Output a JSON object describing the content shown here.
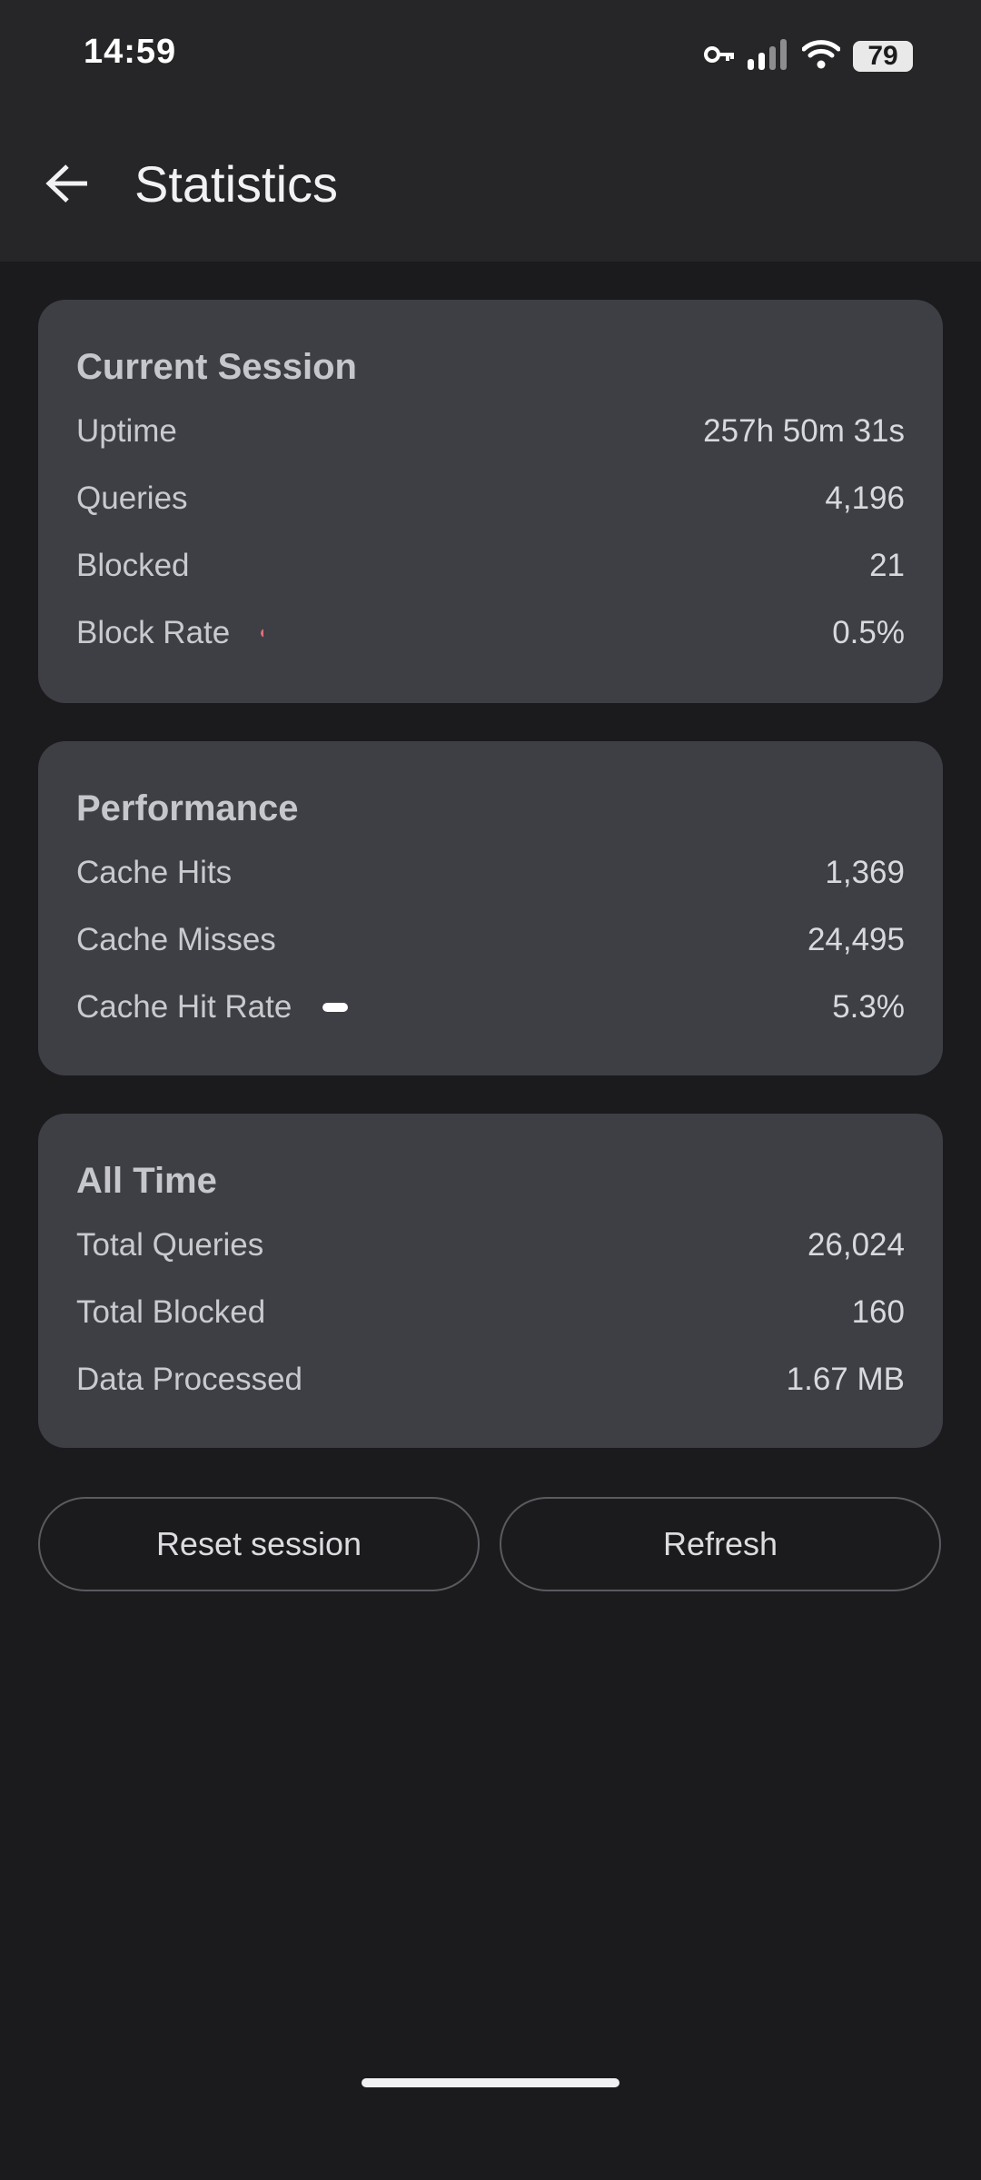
{
  "status_bar": {
    "time": "14:59",
    "battery": "79",
    "icons": [
      "vpn-key-icon",
      "cell-signal-icon",
      "wifi-icon",
      "battery-icon"
    ]
  },
  "header": {
    "title": "Statistics",
    "back_icon": "arrow-left-icon"
  },
  "current_session": {
    "title": "Current Session",
    "rows": [
      {
        "label": "Uptime",
        "value": "257h 50m 31s"
      },
      {
        "label": "Queries",
        "value": "4,196"
      },
      {
        "label": "Blocked",
        "value": "21"
      },
      {
        "label": "Block Rate",
        "value": "0.5%",
        "bar_fraction": 0.005,
        "bar_color": "#e0707a"
      }
    ]
  },
  "performance": {
    "title": "Performance",
    "rows": [
      {
        "label": "Cache Hits",
        "value": "1,369"
      },
      {
        "label": "Cache Misses",
        "value": "24,495"
      },
      {
        "label": "Cache Hit Rate",
        "value": "5.3%",
        "bar_fraction": 0.053,
        "bar_color": "#ffffff"
      }
    ]
  },
  "all_time": {
    "title": "All Time",
    "rows": [
      {
        "label": "Total Queries",
        "value": "26,024"
      },
      {
        "label": "Total Blocked",
        "value": "160"
      },
      {
        "label": "Data Processed",
        "value": "1.67 MB"
      }
    ]
  },
  "actions": {
    "reset_label": "Reset session",
    "refresh_label": "Refresh"
  },
  "colors": {
    "background": "#1b1b1d",
    "app_bar": "#262628",
    "card": "#3e3f45"
  }
}
